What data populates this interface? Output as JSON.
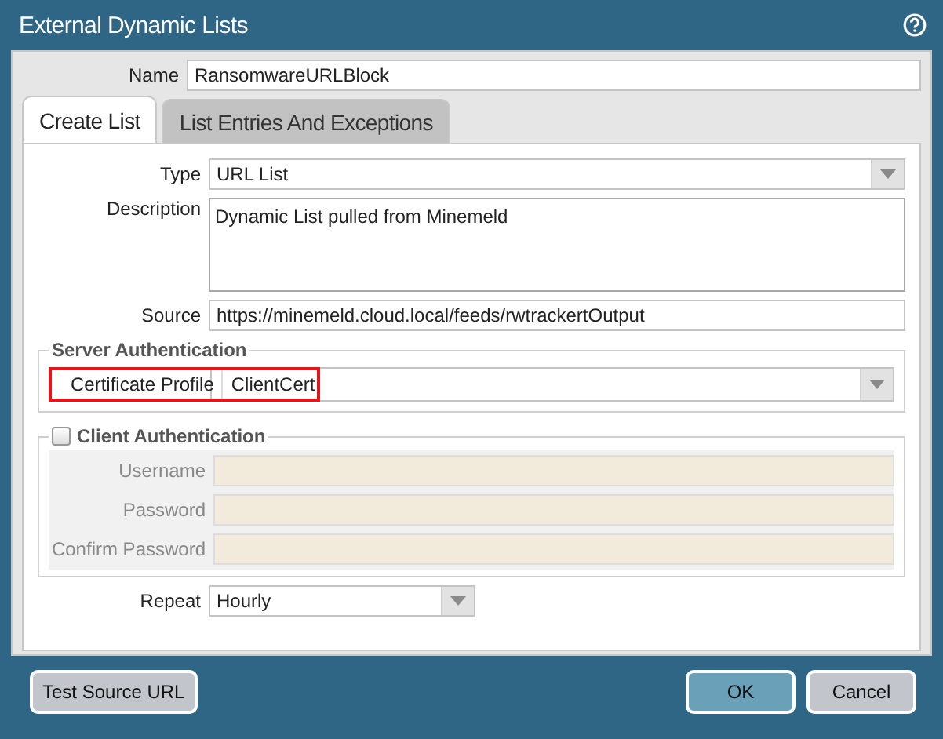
{
  "window": {
    "title": "External Dynamic Lists"
  },
  "name": {
    "label": "Name",
    "value": "RansomwareURLBlock"
  },
  "tabs": [
    {
      "label": "Create List",
      "selected": true
    },
    {
      "label": "List Entries And Exceptions",
      "selected": false
    }
  ],
  "type": {
    "label": "Type",
    "value": "URL List"
  },
  "description": {
    "label": "Description",
    "value": "Dynamic List pulled from Minemeld"
  },
  "source": {
    "label": "Source",
    "value": "https://minemeld.cloud.local/feeds/rwtrackertOutput"
  },
  "server_authentication": {
    "title": "Server Authentication",
    "certificate_profile": {
      "label": "Certificate Profile",
      "value": "ClientCert",
      "highlighted": true
    }
  },
  "client_authentication": {
    "title": "Client Authentication",
    "checked": false,
    "fields": [
      {
        "label": "Username"
      },
      {
        "label": "Password"
      },
      {
        "label": "Confirm Password"
      }
    ]
  },
  "repeat": {
    "label": "Repeat",
    "value": "Hourly"
  },
  "buttons": [
    {
      "label": "Test Source URL",
      "kind": "secondary"
    },
    {
      "label": "OK",
      "kind": "primary"
    },
    {
      "label": "Cancel",
      "kind": "secondary"
    }
  ]
}
